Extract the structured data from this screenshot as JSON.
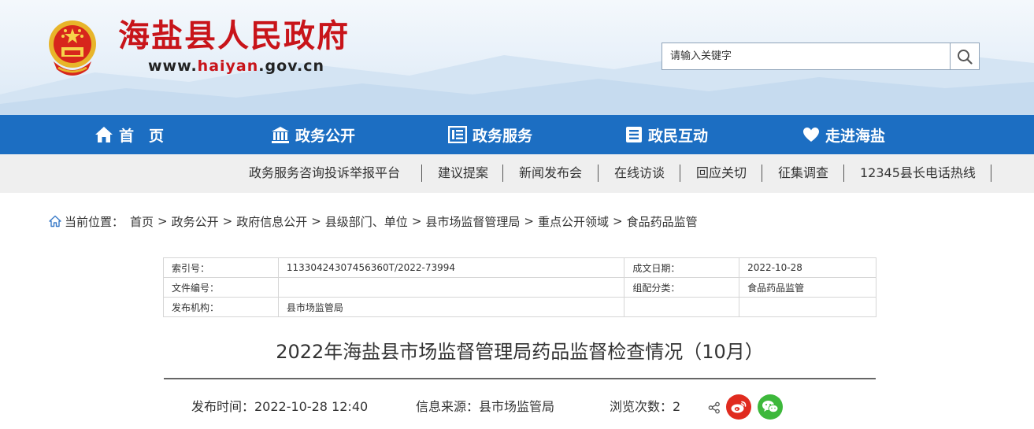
{
  "header": {
    "site_title": "海盐县人民政府",
    "url_prefix": "www.",
    "url_highlight": "haiyan",
    "url_suffix": ".gov.cn",
    "search_placeholder": "请输入关键字",
    "search_icon": "search-icon",
    "emblem_icon": "national-emblem-icon"
  },
  "nav": {
    "items": [
      {
        "label": "首　页",
        "icon": "home-icon"
      },
      {
        "label": "政务公开",
        "icon": "government-building-icon"
      },
      {
        "label": "政务服务",
        "icon": "service-list-icon"
      },
      {
        "label": "政民互动",
        "icon": "document-icon"
      },
      {
        "label": "走进海盐",
        "icon": "heart-icon"
      }
    ]
  },
  "subnav": {
    "links": [
      "政务服务咨询投诉举报平台",
      "建议提案",
      "新闻发布会",
      "在线访谈",
      "回应关切",
      "征集调查",
      "12345县长电话热线"
    ]
  },
  "breadcrumb": {
    "prefix": "当前位置：",
    "items": [
      "首页",
      "政务公开",
      "政府信息公开",
      "县级部门、单位",
      "县市场监督管理局",
      "重点公开领域",
      "食品药品监管"
    ],
    "separator": ">"
  },
  "info": {
    "rows": [
      {
        "k1": "索引号：",
        "v1": "11330424307456360T/2022-73994",
        "k2": "成文日期：",
        "v2": "2022-10-28"
      },
      {
        "k1": "文件编号：",
        "v1": "",
        "k2": "组配分类：",
        "v2": "食品药品监管"
      },
      {
        "k1": "发布机构：",
        "v1": "县市场监管局",
        "k2": "",
        "v2": ""
      }
    ]
  },
  "article": {
    "title": "2022年海盐县市场监督管理局药品监督检查情况（10月）",
    "publish_time": "发布时间：2022-10-28 12:40",
    "source": "信息来源：县市场监管局",
    "views": "浏览次数：2",
    "share_icons": [
      "share-icon",
      "weibo-icon",
      "wechat-icon"
    ]
  },
  "colors": {
    "brand_red": "#c8141a",
    "nav_blue": "#1c6ec2",
    "subnav_bg": "#efefef",
    "weibo_red": "#e02b1f",
    "wechat_green": "#3db83b"
  }
}
